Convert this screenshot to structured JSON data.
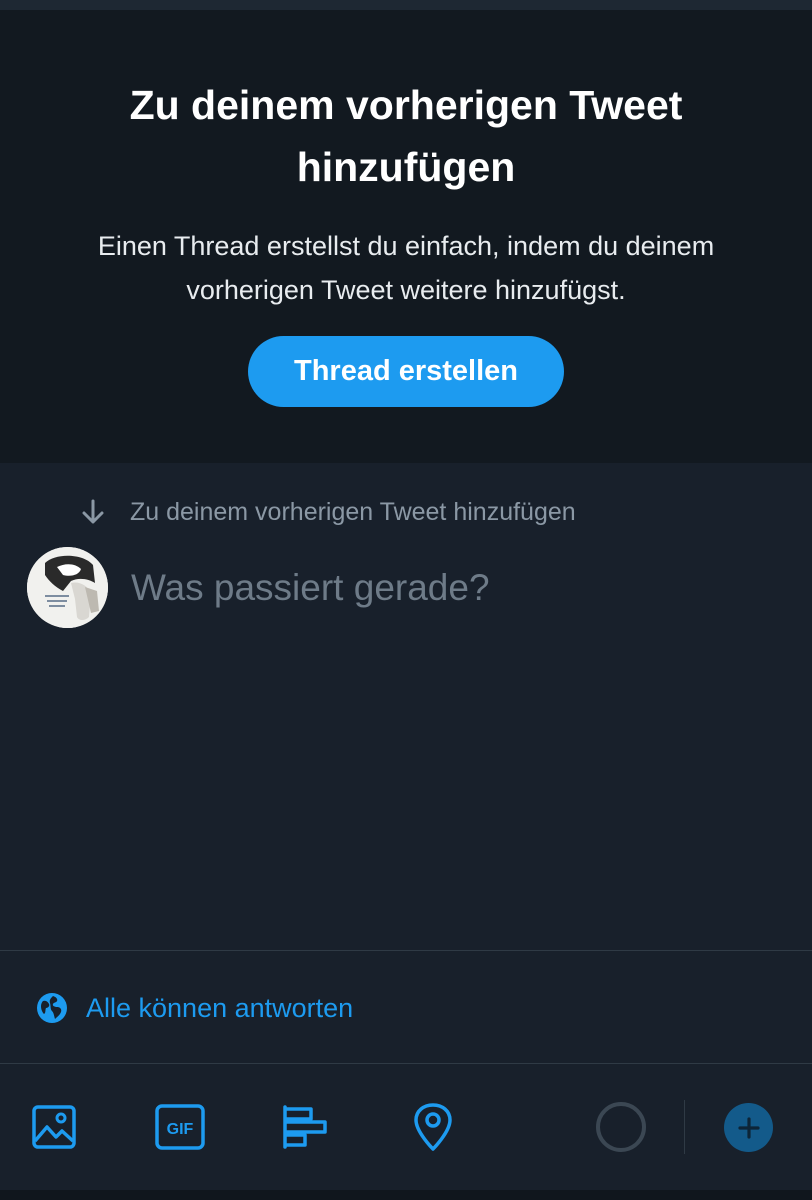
{
  "promo": {
    "title": "Zu deinem vorherigen Tweet hinzufügen",
    "text": "Einen Thread erstellst du einfach, indem du deinem vorherigen Tweet weitere hinzufügst.",
    "button_label": "Thread erstellen"
  },
  "composer": {
    "reply_hint": "Zu deinem vorherigen Tweet hinzufügen",
    "placeholder": "Was passiert gerade?",
    "value": ""
  },
  "reply_setting": {
    "label": "Alle können antworten",
    "icon": "globe-icon"
  },
  "toolbar": {
    "icons": [
      "image-icon",
      "gif-icon",
      "poll-icon",
      "location-icon",
      "character-counter",
      "add-tweet-icon"
    ],
    "gif_label": "GIF"
  },
  "colors": {
    "accent": "#1d9bf0",
    "background": "#18202b",
    "promo_background": "#121920",
    "muted_text": "#8b98a5"
  }
}
